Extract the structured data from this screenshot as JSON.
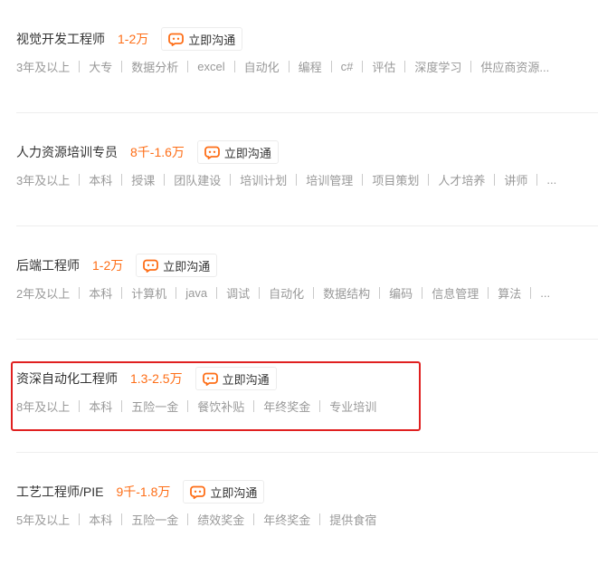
{
  "jobs": [
    {
      "title": "视觉开发工程师",
      "salary": "1-2万",
      "chat_label": "立即沟通",
      "tags": [
        "3年及以上",
        "大专",
        "数据分析",
        "excel",
        "自动化",
        "编程",
        "c#",
        "评估",
        "深度学习",
        "供应商资源..."
      ]
    },
    {
      "title": "人力资源培训专员",
      "salary": "8千-1.6万",
      "chat_label": "立即沟通",
      "tags": [
        "3年及以上",
        "本科",
        "授课",
        "团队建设",
        "培训计划",
        "培训管理",
        "项目策划",
        "人才培养",
        "讲师",
        "..."
      ]
    },
    {
      "title": "后端工程师",
      "salary": "1-2万",
      "chat_label": "立即沟通",
      "tags": [
        "2年及以上",
        "本科",
        "计算机",
        "java",
        "调试",
        "自动化",
        "数据结构",
        "编码",
        "信息管理",
        "算法",
        "..."
      ]
    },
    {
      "title": "资深自动化工程师",
      "salary": "1.3-2.5万",
      "chat_label": "立即沟通",
      "tags": [
        "8年及以上",
        "本科",
        "五险一金",
        "餐饮补贴",
        "年终奖金",
        "专业培训"
      ]
    },
    {
      "title": "工艺工程师/PIE",
      "salary": "9千-1.8万",
      "chat_label": "立即沟通",
      "tags": [
        "5年及以上",
        "本科",
        "五险一金",
        "绩效奖金",
        "年终奖金",
        "提供食宿"
      ]
    }
  ],
  "colors": {
    "salary": "#fe6e17",
    "chat_icon": "#fe6e17",
    "highlight": "#e02020"
  },
  "icons": {
    "chat": "chat-bubble-icon"
  }
}
